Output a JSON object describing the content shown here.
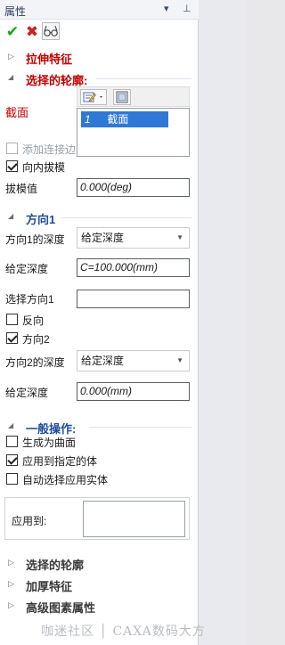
{
  "panel": {
    "title": "属性",
    "dropdown_glyph": "▾",
    "pin_glyph": "⊥"
  },
  "toolbar": {
    "ok_icon": "check-icon",
    "cancel_icon": "close-icon",
    "preview_icon": "glasses-icon",
    "ok_glyph": "✔",
    "cancel_glyph": "✖"
  },
  "sections": {
    "extrude": {
      "label": "拉伸特征",
      "expanded": false
    },
    "profile": {
      "label": "选择的轮廓:",
      "expanded": true,
      "field_label": "截面",
      "list": [
        {
          "index": "1",
          "name": "截面",
          "selected": true
        }
      ]
    },
    "options": {
      "add_join_edge": {
        "label": "添加连接边",
        "checked": false,
        "enabled": false
      },
      "inward_draft": {
        "label": "向内拔模",
        "checked": true
      },
      "draft_value_label": "拔模值",
      "draft_value": "0.000(deg)"
    },
    "direction1": {
      "label": "方向1",
      "depth_label": "方向1的深度",
      "depth_type": "给定深度",
      "given_depth_label": "给定深度",
      "given_depth": "C=100.000(mm)",
      "select_dir_label": "选择方向1",
      "select_dir_value": "",
      "reverse": {
        "label": "反向",
        "checked": false
      },
      "direction2": {
        "label": "方向2",
        "checked": true
      },
      "depth2_label": "方向2的深度",
      "depth2_type": "给定深度",
      "given_depth2_label": "给定深度",
      "given_depth2": "0.000(mm)"
    },
    "general": {
      "label": "一般操作:",
      "make_surface": {
        "label": "生成为曲面",
        "checked": false
      },
      "apply_to_body": {
        "label": "应用到指定的体",
        "checked": true
      },
      "auto_select": {
        "label": "自动选择应用实体",
        "checked": false
      },
      "apply_to_label": "应用到:"
    },
    "collapsed": [
      {
        "label": "选择的轮廓"
      },
      {
        "label": "加厚特征"
      },
      {
        "label": "高级图素属性"
      }
    ]
  },
  "watermark": "咖迷社区 │ CAXA数码大方",
  "colors": {
    "section_red": "#c40000",
    "section_blue": "#1f4e9a",
    "selection": "#2f78d6",
    "ok": "#1aa11a",
    "cancel": "#d02020"
  }
}
